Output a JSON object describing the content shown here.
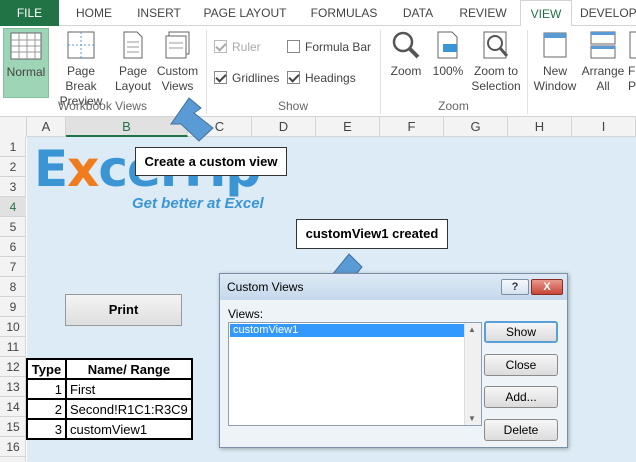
{
  "ribbon_tabs": [
    "FILE",
    "HOME",
    "INSERT",
    "PAGE LAYOUT",
    "FORMULAS",
    "DATA",
    "REVIEW",
    "VIEW",
    "DEVELOP"
  ],
  "workbook_views": {
    "normal": "Normal",
    "page_break_1": "Page Break",
    "page_break_2": "Preview",
    "page_layout_1": "Page",
    "page_layout_2": "Layout",
    "custom_views_1": "Custom",
    "custom_views_2": "Views",
    "group_label": "Workbook Views"
  },
  "show": {
    "ruler": "Ruler",
    "formula_bar": "Formula Bar",
    "gridlines": "Gridlines",
    "headings": "Headings",
    "group_label": "Show",
    "ruler_checked": true,
    "formula_bar_checked": false,
    "gridlines_checked": true,
    "headings_checked": true
  },
  "zoom": {
    "zoom": "Zoom",
    "hundred": "100%",
    "zoom_sel_1": "Zoom to",
    "zoom_sel_2": "Selection",
    "group_label": "Zoom"
  },
  "window": {
    "new_window_1": "New",
    "new_window_2": "Window",
    "arrange_1": "Arrange",
    "arrange_2": "All",
    "freeze_1": "F",
    "freeze_2": "P"
  },
  "columns": [
    "A",
    "B",
    "C",
    "D",
    "E",
    "F",
    "G",
    "H",
    "I"
  ],
  "rows": [
    "1",
    "2",
    "3",
    "4",
    "5",
    "6",
    "7",
    "8",
    "9",
    "10",
    "11",
    "12",
    "13",
    "14",
    "15",
    "16"
  ],
  "selected_cell": {
    "column": "B",
    "row": "4"
  },
  "logo": {
    "brand_a": "E",
    "brand_x": "x",
    "brand_b": "celTip",
    "tagline": "Get better at Excel"
  },
  "callouts": {
    "custom_view": "Create a custom view",
    "created": "customView1 created"
  },
  "print_button": "Print",
  "table": {
    "headers": [
      "Type",
      "Name/ Range"
    ],
    "rows": [
      {
        "type": "1",
        "name": "First"
      },
      {
        "type": "2",
        "name": "Second!R1C1:R3C9"
      },
      {
        "type": "3",
        "name": "customView1"
      }
    ]
  },
  "dialog": {
    "title": "Custom Views",
    "help": "?",
    "close": "X",
    "views_label": "Views:",
    "items": [
      "customView1"
    ],
    "show": "Show",
    "close_btn": "Close",
    "add": "Add...",
    "delete": "Delete"
  },
  "colors": {
    "excel_green": "#217346",
    "sheet_bg": "#dcebf5",
    "callout_arrow": "#5b9bd5",
    "selection_blue": "#3399ff"
  }
}
